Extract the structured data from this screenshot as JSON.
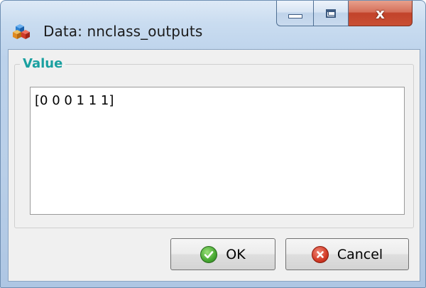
{
  "window": {
    "title": "Data: nnclass_outputs",
    "app_icon": "cubes-icon",
    "close_glyph": "x"
  },
  "group": {
    "label": "Value"
  },
  "value_box": {
    "text": "[0 0 0 1 1 1]"
  },
  "buttons": {
    "ok": {
      "label": "OK",
      "icon": "checkmark-icon"
    },
    "cancel": {
      "label": "Cancel",
      "icon": "cancel-x-icon"
    }
  },
  "colors": {
    "group_label": "#1aa0a0",
    "close_button": "#c94f34",
    "ok_icon": "#47a832",
    "cancel_icon": "#d23a26"
  }
}
